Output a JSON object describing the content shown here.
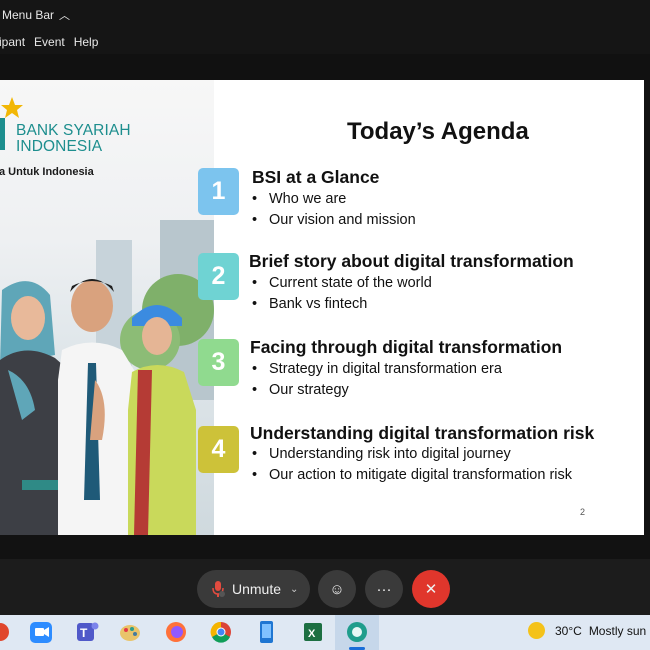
{
  "window": {
    "menu_bar_label": "Menu Bar",
    "menu_items": [
      "ipant",
      "Event",
      "Help"
    ]
  },
  "slide": {
    "logo_line1": "BANK SYARIAH",
    "logo_line2": "INDONESIA",
    "tagline": "a Untuk Indonesia",
    "title": "Today’s Agenda",
    "items": [
      {
        "number": "1",
        "color": "#7cc4ee",
        "heading": "BSI at a Glance",
        "bullets": [
          "Who we are",
          "Our vision and mission"
        ]
      },
      {
        "number": "2",
        "color": "#6fd3d3",
        "heading": "Brief story about digital transformation",
        "bullets": [
          "Current state of the world",
          "Bank vs fintech"
        ]
      },
      {
        "number": "3",
        "color": "#90da8f",
        "heading": "Facing through digital transformation",
        "bullets": [
          "Strategy in digital transformation era",
          "Our strategy"
        ]
      },
      {
        "number": "4",
        "color": "#cdc239",
        "heading": "Understanding digital transformation risk",
        "bullets": [
          "Understanding risk into digital journey",
          "Our action to mitigate digital transformation risk"
        ]
      }
    ],
    "page_number": "2"
  },
  "controls": {
    "unmute_label": "Unmute",
    "more_label": "···",
    "leave_label": "✕"
  },
  "taskbar": {
    "icons": [
      "app-red-icon",
      "zoom-icon",
      "teams-icon",
      "paint-icon",
      "firefox-icon",
      "chrome-icon",
      "phone-icon",
      "excel-icon",
      "zoom-meeting-icon"
    ],
    "weather_temp": "30°C",
    "weather_condition": "Mostly sun"
  }
}
